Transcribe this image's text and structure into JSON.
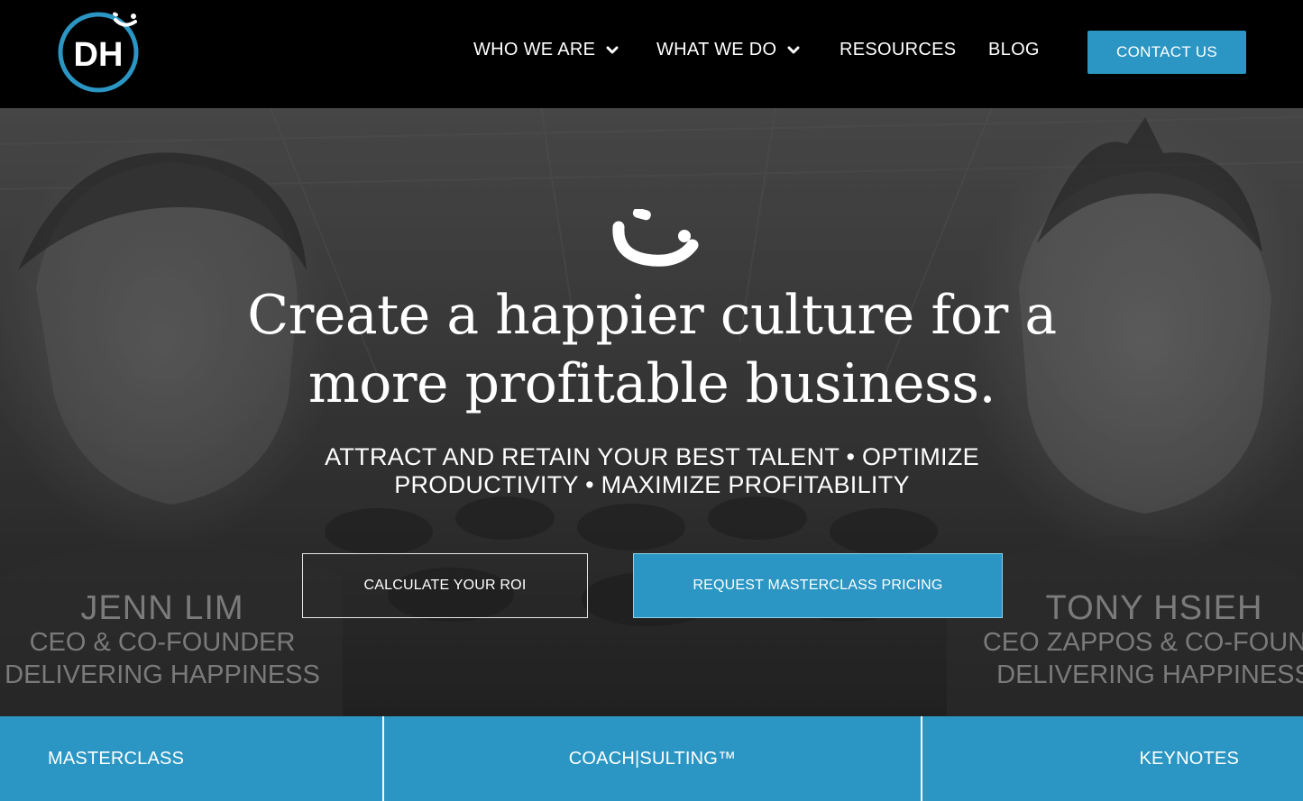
{
  "header": {
    "logo_text": "DH",
    "nav": [
      {
        "label": "WHO WE ARE",
        "has_dropdown": true,
        "icon": "chevron-down-icon"
      },
      {
        "label": "WHAT WE DO",
        "has_dropdown": true,
        "icon": "chevron-down-icon"
      },
      {
        "label": "RESOURCES",
        "has_dropdown": false
      },
      {
        "label": "BLOG",
        "has_dropdown": false
      }
    ],
    "contact_label": "CONTACT US"
  },
  "hero": {
    "headline_line1": "Create a happier culture for a",
    "headline_line2": "more profitable business.",
    "subline_line1": "ATTRACT AND RETAIN YOUR BEST TALENT • OPTIMIZE",
    "subline_line2": "PRODUCTIVITY • MAXIMIZE PROFITABILITY",
    "left_person": {
      "name": "JENN LIM",
      "title1": "CEO  & CO-FOUNDER",
      "title2": "DELIVERING HAPPINESS"
    },
    "right_person": {
      "name": "TONY HSIEH",
      "title1": "CEO ZAPPOS  & CO-FOUND",
      "title2": "DELIVERING HAPPINESS"
    },
    "btn_roi": "CALCULATE YOUR ROI",
    "btn_pricing": "REQUEST MASTERCLASS PRICING"
  },
  "tiles": [
    {
      "label": "MASTERCLASS"
    },
    {
      "label": "COACH|SULTING™"
    },
    {
      "label": "KEYNOTES"
    }
  ],
  "colors": {
    "accent": "#2b96c3",
    "header_bg": "#000000",
    "text": "#ffffff"
  }
}
